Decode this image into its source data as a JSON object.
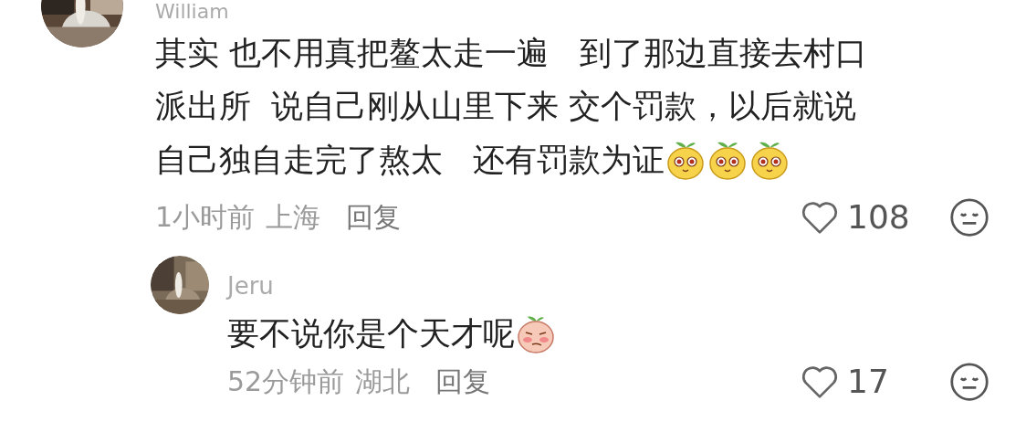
{
  "comment": {
    "author": "William",
    "lines": [
      "其实 也不用真把鳌太走一遍   到了那边直接去村口",
      "派出所  说自己刚从山里下来 交个罚款，以后就说",
      "自己独自走完了熬太   还有罚款为证"
    ],
    "stickers": [
      {
        "kind": "sprout"
      },
      {
        "kind": "sprout"
      },
      {
        "kind": "sprout"
      }
    ],
    "time": "1小时前",
    "location": "上海",
    "reply_label": "回复",
    "likes": "108"
  },
  "reply": {
    "author": "Jeru",
    "lines": [
      "要不说你是个天才呢"
    ],
    "stickers": [
      {
        "kind": "blush"
      }
    ],
    "time": "52分钟前",
    "location": "湖北",
    "reply_label": "回复",
    "likes": "17"
  }
}
